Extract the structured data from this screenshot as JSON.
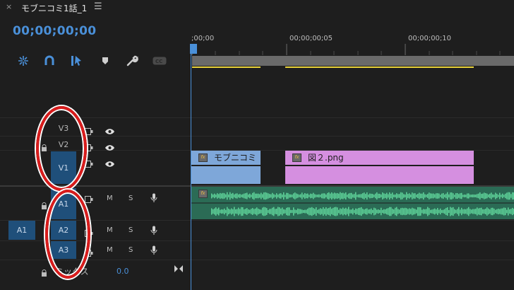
{
  "tab": {
    "close_icon": "×",
    "title": "モブニコミ1話_1",
    "menu_icon": "☰"
  },
  "timecode": "00;00;00;00",
  "ruler": {
    "ticks": [
      ";00;00",
      "00;00;00;05",
      "00;00;00;10"
    ]
  },
  "tracks": {
    "video": [
      {
        "id": "V3",
        "target": false
      },
      {
        "id": "V2",
        "target": false
      },
      {
        "id": "V1",
        "target": true
      }
    ],
    "audio": [
      {
        "id": "A1",
        "target": true
      },
      {
        "id": "A2",
        "target": true,
        "source": "A1"
      },
      {
        "id": "A3",
        "target": true
      }
    ],
    "audio_buttons": {
      "mute": "M",
      "solo": "S"
    }
  },
  "clips": {
    "v1_a": {
      "name": "モブニコミ",
      "fx": "fx"
    },
    "v1_b": {
      "name": "図２.png",
      "fx": "fx"
    },
    "a1": {
      "fx": "fx"
    }
  },
  "mix": {
    "label": "ミックス",
    "value": "0.0"
  },
  "colors": {
    "accent": "#4a90d9",
    "video_clip": "#7ea7d9",
    "image_clip": "#d58fe0",
    "audio_clip": "#2b6b55",
    "annotation": "#d91c1c"
  },
  "icons": [
    "snap-icon",
    "linked-selection-icon",
    "selection-tool-icon",
    "marker-icon",
    "wrench-icon",
    "captions-icon"
  ]
}
